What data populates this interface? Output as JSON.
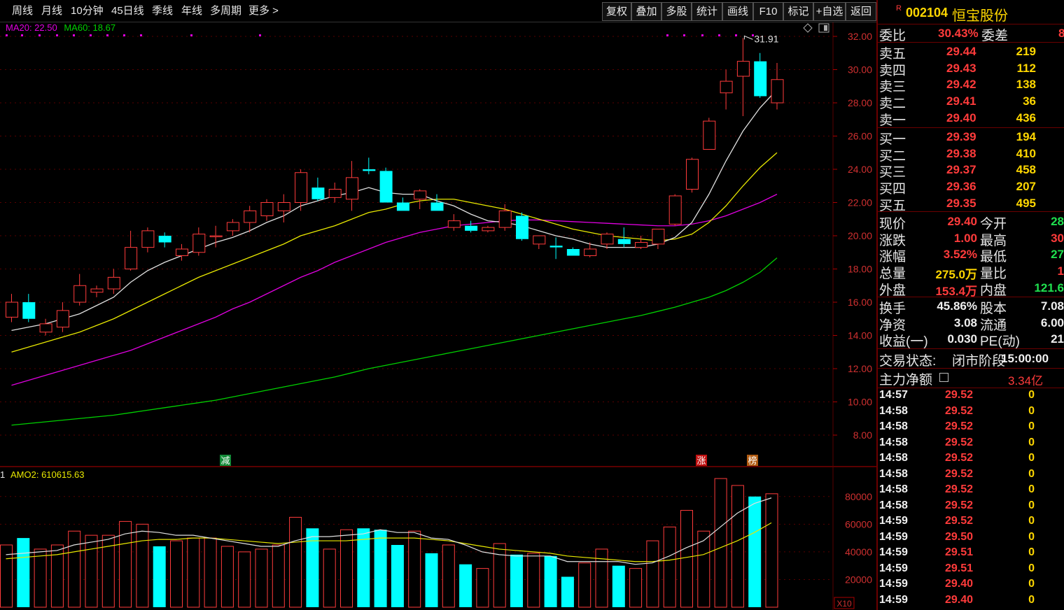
{
  "toolbar": {
    "left_items": [
      "周线",
      "月线",
      "10分钟",
      "45日线",
      "季线",
      "年线",
      "多周期",
      "更多 >"
    ],
    "right_items": [
      "复权",
      "叠加",
      "多股",
      "统计",
      "画线",
      "F10",
      "标记",
      "+自选",
      "返回"
    ]
  },
  "ma_legend": {
    "ma20": "MA20: 22.50",
    "ma60": "MA60: 18.67"
  },
  "price_axis": {
    "ticks": [
      "32.00",
      "30.00",
      "28.00",
      "26.00",
      "24.00",
      "22.00",
      "20.00",
      "18.00",
      "16.00",
      "14.00",
      "12.00",
      "10.00",
      "8.00"
    ]
  },
  "high_label": "31.91",
  "event_markers": [
    "减",
    "涨",
    "榜"
  ],
  "volume": {
    "legend_prefix": "1",
    "legend": "AMO2: 610615.63",
    "ticks": [
      "80000",
      "60000",
      "40000",
      "20000"
    ],
    "unit": "X10"
  },
  "colors": {
    "up": "#ff3b3b",
    "down": "#00ffff",
    "ma5": "#e0e0e0",
    "ma10": "#e8e800",
    "ma20": "#e000e0",
    "ma60": "#00d000",
    "grid": "#5a0000"
  },
  "chart_data": {
    "type": "candlestick",
    "candles": [
      {
        "o": 15.1,
        "h": 16.5,
        "l": 14.8,
        "c": 16.0
      },
      {
        "o": 16.0,
        "h": 16.5,
        "l": 14.8,
        "c": 15.0
      },
      {
        "o": 14.2,
        "h": 15.0,
        "l": 14.0,
        "c": 14.7
      },
      {
        "o": 14.5,
        "h": 16.0,
        "l": 14.2,
        "c": 15.5
      },
      {
        "o": 16.0,
        "h": 17.7,
        "l": 15.8,
        "c": 17.0
      },
      {
        "o": 16.6,
        "h": 17.0,
        "l": 16.3,
        "c": 16.8
      },
      {
        "o": 16.8,
        "h": 18.0,
        "l": 16.5,
        "c": 17.5
      },
      {
        "o": 18.0,
        "h": 20.3,
        "l": 17.9,
        "c": 19.3
      },
      {
        "o": 19.3,
        "h": 20.5,
        "l": 19.0,
        "c": 20.3
      },
      {
        "o": 20.0,
        "h": 20.2,
        "l": 19.3,
        "c": 19.6
      },
      {
        "o": 18.8,
        "h": 19.5,
        "l": 18.5,
        "c": 19.2
      },
      {
        "o": 19.0,
        "h": 20.5,
        "l": 18.8,
        "c": 20.1
      },
      {
        "o": 20.0,
        "h": 20.6,
        "l": 19.3,
        "c": 20.0
      },
      {
        "o": 20.3,
        "h": 21.0,
        "l": 20.0,
        "c": 20.8
      },
      {
        "o": 20.8,
        "h": 21.8,
        "l": 20.2,
        "c": 21.5
      },
      {
        "o": 21.2,
        "h": 22.2,
        "l": 20.9,
        "c": 22.0
      },
      {
        "o": 21.5,
        "h": 22.5,
        "l": 20.8,
        "c": 22.0
      },
      {
        "o": 22.0,
        "h": 24.0,
        "l": 21.5,
        "c": 23.8
      },
      {
        "o": 22.9,
        "h": 23.5,
        "l": 22.1,
        "c": 22.2
      },
      {
        "o": 22.3,
        "h": 23.2,
        "l": 22.0,
        "c": 22.8
      },
      {
        "o": 22.2,
        "h": 24.5,
        "l": 21.5,
        "c": 23.5
      },
      {
        "o": 24.0,
        "h": 24.7,
        "l": 23.7,
        "c": 23.9
      },
      {
        "o": 23.9,
        "h": 24.1,
        "l": 22.0,
        "c": 22.0
      },
      {
        "o": 22.0,
        "h": 22.3,
        "l": 21.5,
        "c": 21.5
      },
      {
        "o": 22.2,
        "h": 22.8,
        "l": 21.6,
        "c": 22.7
      },
      {
        "o": 22.0,
        "h": 22.5,
        "l": 21.5,
        "c": 21.5
      },
      {
        "o": 20.5,
        "h": 21.3,
        "l": 20.3,
        "c": 20.9
      },
      {
        "o": 20.6,
        "h": 20.9,
        "l": 20.2,
        "c": 20.3
      },
      {
        "o": 20.3,
        "h": 20.6,
        "l": 20.2,
        "c": 20.5
      },
      {
        "o": 20.5,
        "h": 21.9,
        "l": 20.3,
        "c": 21.5
      },
      {
        "o": 21.2,
        "h": 21.4,
        "l": 19.7,
        "c": 19.8
      },
      {
        "o": 19.5,
        "h": 20.0,
        "l": 19.2,
        "c": 20.0
      },
      {
        "o": 19.4,
        "h": 19.9,
        "l": 18.6,
        "c": 19.3
      },
      {
        "o": 19.2,
        "h": 19.3,
        "l": 18.8,
        "c": 18.8
      },
      {
        "o": 18.8,
        "h": 19.6,
        "l": 18.7,
        "c": 19.2
      },
      {
        "o": 19.5,
        "h": 20.2,
        "l": 19.2,
        "c": 20.1
      },
      {
        "o": 19.8,
        "h": 20.5,
        "l": 19.3,
        "c": 19.5
      },
      {
        "o": 19.3,
        "h": 20.0,
        "l": 19.2,
        "c": 19.6
      },
      {
        "o": 19.5,
        "h": 20.3,
        "l": 19.2,
        "c": 20.4
      },
      {
        "o": 20.7,
        "h": 22.5,
        "l": 20.6,
        "c": 22.4
      },
      {
        "o": 22.8,
        "h": 24.7,
        "l": 22.6,
        "c": 24.6
      },
      {
        "o": 25.2,
        "h": 27.1,
        "l": 25.2,
        "c": 26.9
      },
      {
        "o": 28.6,
        "h": 30.0,
        "l": 27.6,
        "c": 29.3
      },
      {
        "o": 29.6,
        "h": 31.9,
        "l": 27.2,
        "c": 30.5
      },
      {
        "o": 30.5,
        "h": 31.0,
        "l": 28.3,
        "c": 28.4
      },
      {
        "o": 28.0,
        "h": 30.4,
        "l": 27.6,
        "c": 29.4
      }
    ],
    "ma5": [
      14.3,
      14.5,
      14.7,
      15.0,
      15.3,
      15.8,
      16.3,
      17.2,
      17.9,
      18.4,
      18.8,
      19.2,
      19.6,
      19.9,
      20.3,
      20.8,
      21.2,
      21.8,
      22.1,
      22.4,
      22.6,
      22.9,
      22.6,
      22.5,
      22.5,
      22.1,
      21.8,
      21.3,
      20.9,
      20.8,
      20.6,
      20.3,
      20.0,
      19.8,
      19.5,
      19.3,
      19.3,
      19.3,
      19.5,
      19.9,
      20.8,
      22.5,
      24.5,
      26.3,
      27.7,
      28.8
    ],
    "ma10": [
      13.0,
      13.3,
      13.6,
      13.9,
      14.2,
      14.6,
      15.0,
      15.5,
      16.0,
      16.5,
      17.0,
      17.5,
      17.9,
      18.3,
      18.7,
      19.1,
      19.5,
      20.0,
      20.3,
      20.6,
      21.0,
      21.4,
      21.6,
      21.9,
      22.1,
      22.2,
      22.2,
      22.0,
      21.8,
      21.6,
      21.3,
      21.0,
      20.7,
      20.4,
      20.2,
      20.0,
      19.9,
      19.8,
      19.7,
      19.8,
      20.1,
      20.8,
      21.8,
      23.0,
      24.1,
      25.0
    ],
    "ma20": [
      11.0,
      11.3,
      11.6,
      11.9,
      12.2,
      12.5,
      12.8,
      13.1,
      13.5,
      13.9,
      14.3,
      14.7,
      15.1,
      15.6,
      16.0,
      16.5,
      17.0,
      17.5,
      17.9,
      18.4,
      18.8,
      19.2,
      19.6,
      19.9,
      20.2,
      20.4,
      20.6,
      20.7,
      20.8,
      20.9,
      20.95,
      20.95,
      20.9,
      20.85,
      20.8,
      20.75,
      20.7,
      20.65,
      20.6,
      20.6,
      20.7,
      20.9,
      21.2,
      21.6,
      22.0,
      22.5
    ],
    "ma60": [
      8.6,
      8.7,
      8.8,
      8.9,
      9.0,
      9.1,
      9.2,
      9.35,
      9.5,
      9.65,
      9.8,
      9.95,
      10.1,
      10.3,
      10.5,
      10.7,
      10.9,
      11.1,
      11.3,
      11.5,
      11.75,
      12.0,
      12.2,
      12.4,
      12.6,
      12.8,
      13.0,
      13.2,
      13.4,
      13.6,
      13.8,
      14.0,
      14.2,
      14.4,
      14.6,
      14.8,
      15.0,
      15.2,
      15.45,
      15.7,
      16.0,
      16.3,
      16.7,
      17.2,
      17.8,
      18.67
    ],
    "volume": [
      45000,
      50000,
      42000,
      45000,
      55000,
      52000,
      52000,
      62000,
      60000,
      44000,
      48000,
      50000,
      50000,
      44000,
      40000,
      42000,
      45000,
      65000,
      57000,
      42000,
      56000,
      57000,
      56000,
      45000,
      55000,
      39000,
      45000,
      31000,
      28000,
      46000,
      38000,
      39000,
      37000,
      22000,
      32000,
      42000,
      30000,
      28000,
      48000,
      58000,
      70000,
      55000,
      93000,
      88000,
      80000,
      82000
    ],
    "vol_ma1": [
      38000,
      39000,
      40000,
      41000,
      45000,
      47000,
      49000,
      53000,
      55000,
      54000,
      52000,
      52000,
      50000,
      48000,
      46000,
      44000,
      44000,
      48000,
      51000,
      51000,
      52000,
      53000,
      56000,
      54000,
      54000,
      50000,
      49000,
      45000,
      40000,
      38000,
      37000,
      37000,
      37000,
      33000,
      33000,
      33000,
      33000,
      31000,
      32000,
      37000,
      43000,
      48000,
      58000,
      68000,
      75000,
      79000
    ],
    "vol_ma2": [
      35000,
      36000,
      37000,
      38000,
      40000,
      42000,
      44000,
      46000,
      48000,
      49000,
      49000,
      50000,
      50000,
      49000,
      48000,
      47000,
      46000,
      47000,
      48000,
      48000,
      48000,
      49000,
      50000,
      50000,
      50000,
      49000,
      48000,
      46000,
      44000,
      42000,
      41000,
      40000,
      39000,
      37000,
      36000,
      35000,
      34000,
      33000,
      33000,
      34000,
      36000,
      38000,
      43000,
      48000,
      54000,
      61000
    ]
  },
  "quote": {
    "code_prefix": "R",
    "code": "002104",
    "name": "恒宝股份",
    "wei_bi_label": "委比",
    "wei_bi": "30.43%",
    "wei_cha_label": "委差",
    "wei_cha": "8",
    "sell": [
      {
        "label": "卖五",
        "price": "29.44",
        "vol": "219"
      },
      {
        "label": "卖四",
        "price": "29.43",
        "vol": "112"
      },
      {
        "label": "卖三",
        "price": "29.42",
        "vol": "138"
      },
      {
        "label": "卖二",
        "price": "29.41",
        "vol": "36"
      },
      {
        "label": "卖一",
        "price": "29.40",
        "vol": "436"
      }
    ],
    "buy": [
      {
        "label": "买一",
        "price": "29.39",
        "vol": "194"
      },
      {
        "label": "买二",
        "price": "29.38",
        "vol": "410"
      },
      {
        "label": "买三",
        "price": "29.37",
        "vol": "458"
      },
      {
        "label": "买四",
        "price": "29.36",
        "vol": "207"
      },
      {
        "label": "买五",
        "price": "29.35",
        "vol": "495"
      }
    ],
    "stats": [
      {
        "l1": "现价",
        "v1": "29.40",
        "c1": "red",
        "l2": "今开",
        "v2": "28",
        "c2": "grn"
      },
      {
        "l1": "涨跌",
        "v1": "1.00",
        "c1": "red",
        "l2": "最高",
        "v2": "30",
        "c2": "red"
      },
      {
        "l1": "涨幅",
        "v1": "3.52%",
        "c1": "red",
        "l2": "最低",
        "v2": "27",
        "c2": "grn"
      },
      {
        "l1": "总量",
        "v1": "275.0万",
        "c1": "yel",
        "l2": "量比",
        "v2": "1",
        "c2": "red"
      },
      {
        "l1": "外盘",
        "v1": "153.4万",
        "c1": "red",
        "l2": "内盘",
        "v2": "121.6",
        "c2": "grn"
      }
    ],
    "stats2": [
      {
        "l1": "换手",
        "v1": "45.86%",
        "l2": "股本",
        "v2": "7.08"
      },
      {
        "l1": "净资",
        "v1": "3.08",
        "l2": "流通",
        "v2": "6.00"
      },
      {
        "l1": "收益(一)",
        "v1": "0.030",
        "l2": "PE(动)",
        "v2": "21"
      }
    ],
    "trade_state_label": "交易状态:",
    "trade_state": "闭市阶段",
    "trade_time": "15:00:00",
    "main_net_label": "主力净额",
    "main_net": "3.34亿",
    "ticks": [
      {
        "t": "14:57",
        "p": "29.52",
        "v": "0"
      },
      {
        "t": "14:58",
        "p": "29.52",
        "v": "0"
      },
      {
        "t": "14:58",
        "p": "29.52",
        "v": "0"
      },
      {
        "t": "14:58",
        "p": "29.52",
        "v": "0"
      },
      {
        "t": "14:58",
        "p": "29.52",
        "v": "0"
      },
      {
        "t": "14:58",
        "p": "29.52",
        "v": "0"
      },
      {
        "t": "14:58",
        "p": "29.52",
        "v": "0"
      },
      {
        "t": "14:58",
        "p": "29.52",
        "v": "0"
      },
      {
        "t": "14:59",
        "p": "29.52",
        "v": "0"
      },
      {
        "t": "14:59",
        "p": "29.50",
        "v": "0"
      },
      {
        "t": "14:59",
        "p": "29.51",
        "v": "0"
      },
      {
        "t": "14:59",
        "p": "29.51",
        "v": "0"
      },
      {
        "t": "14:59",
        "p": "29.40",
        "v": "0"
      },
      {
        "t": "14:59",
        "p": "29.40",
        "v": "0"
      }
    ]
  }
}
